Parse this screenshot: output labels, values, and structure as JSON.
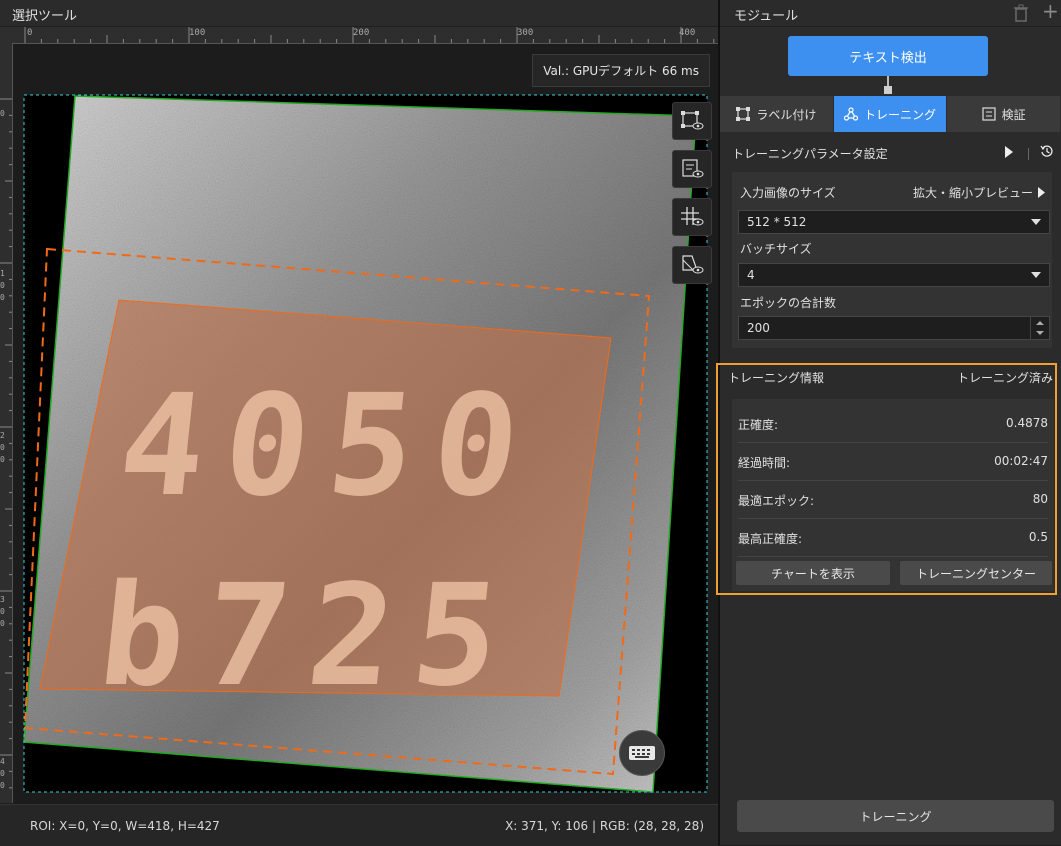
{
  "left_panel": {
    "title": "選択ツール",
    "ruler_ticks": [
      "0",
      "100",
      "200",
      "300",
      "400"
    ],
    "ruler_v_ticks": [
      "0",
      "1",
      "0",
      "0",
      "2",
      "0",
      "0",
      "3",
      "0",
      "0",
      "4",
      "0",
      "0"
    ],
    "val_label": "Val.: GPUデフォルト 66 ms",
    "roi": "ROI: X=0, Y=0, W=418, H=427",
    "coords": "X: 371, Y: 106 | RGB: (28, 28, 28)",
    "overlay_text": [
      "4050",
      "b725"
    ],
    "colors": {
      "region_fill": "#c0714a",
      "region_stroke": "#f06a1a",
      "image_border": "#22aa22",
      "roi_dashed": "#3fd0d0"
    },
    "tools": [
      "roi-view-icon",
      "label-view-icon",
      "grid-view-icon",
      "mask-view-icon"
    ]
  },
  "right_panel": {
    "title": "モジュール",
    "module_node": "テキスト検出",
    "tabs": [
      {
        "label": "ラベル付け",
        "icon": "label-icon"
      },
      {
        "label": "トレーニング",
        "icon": "training-icon",
        "active": true
      },
      {
        "label": "検証",
        "icon": "validate-icon"
      }
    ],
    "params": {
      "title": "トレーニングパラメータ設定",
      "input_size_label": "入力画像のサイズ",
      "preview_label": "拡大・縮小プレビュー",
      "input_size_value": "512 * 512",
      "batch_label": "バッチサイズ",
      "batch_value": "4",
      "epoch_label": "エポックの合計数",
      "epoch_value": "200"
    },
    "info": {
      "title": "トレーニング情報",
      "status": "トレーニング済み",
      "rows": [
        {
          "key": "正確度:",
          "value": "0.4878"
        },
        {
          "key": "経過時間:",
          "value": "00:02:47"
        },
        {
          "key": "最適エポック:",
          "value": "80"
        },
        {
          "key": "最高正確度:",
          "value": "0.5"
        }
      ],
      "chart_button": "チャートを表示",
      "center_button": "トレーニングセンター"
    },
    "train_button": "トレーニング",
    "accent_color": "#3d8ff0",
    "highlight_color": "#f0a030"
  }
}
